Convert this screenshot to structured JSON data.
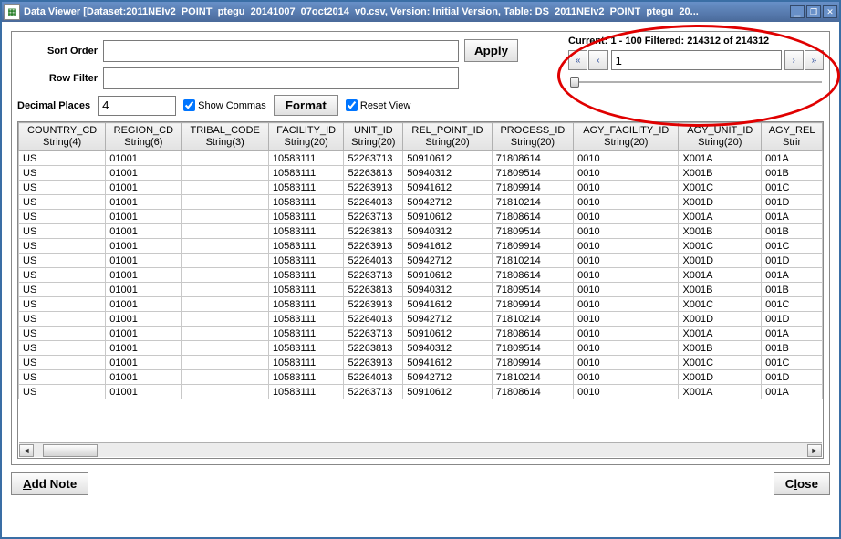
{
  "window": {
    "title": "Data Viewer [Dataset:2011NEIv2_POINT_ptegu_20141007_07oct2014_v0.csv, Version: Initial Version, Table: DS_2011NEIv2_POINT_ptegu_20..."
  },
  "filters": {
    "sort_label": "Sort Order",
    "sort_value": "",
    "rowfilter_label": "Row Filter",
    "rowfilter_value": "",
    "apply_label": "Apply"
  },
  "format": {
    "decimal_label": "Decimal Places",
    "decimal_value": "4",
    "show_commas_label": "Show Commas",
    "show_commas_checked": true,
    "format_label": "Format",
    "reset_view_label": "Reset View",
    "reset_view_checked": true
  },
  "pager": {
    "current_label": "Current:",
    "current_range": "1 - 100",
    "filtered_label": "Filtered:",
    "filtered_count": "214312",
    "of_label": "of",
    "total_count": "214312",
    "page_value": "1"
  },
  "columns": [
    {
      "name": "COUNTRY_CD",
      "type": "String(4)"
    },
    {
      "name": "REGION_CD",
      "type": "String(6)"
    },
    {
      "name": "TRIBAL_CODE",
      "type": "String(3)"
    },
    {
      "name": "FACILITY_ID",
      "type": "String(20)"
    },
    {
      "name": "UNIT_ID",
      "type": "String(20)"
    },
    {
      "name": "REL_POINT_ID",
      "type": "String(20)"
    },
    {
      "name": "PROCESS_ID",
      "type": "String(20)"
    },
    {
      "name": "AGY_FACILITY_ID",
      "type": "String(20)"
    },
    {
      "name": "AGY_UNIT_ID",
      "type": "String(20)"
    },
    {
      "name": "AGY_REL",
      "type": "Strir"
    }
  ],
  "rows": [
    [
      "US",
      "01001",
      "",
      "10583111",
      "52263713",
      "50910612",
      "71808614",
      "0010",
      "X001A",
      "001A"
    ],
    [
      "US",
      "01001",
      "",
      "10583111",
      "52263813",
      "50940312",
      "71809514",
      "0010",
      "X001B",
      "001B"
    ],
    [
      "US",
      "01001",
      "",
      "10583111",
      "52263913",
      "50941612",
      "71809914",
      "0010",
      "X001C",
      "001C"
    ],
    [
      "US",
      "01001",
      "",
      "10583111",
      "52264013",
      "50942712",
      "71810214",
      "0010",
      "X001D",
      "001D"
    ],
    [
      "US",
      "01001",
      "",
      "10583111",
      "52263713",
      "50910612",
      "71808614",
      "0010",
      "X001A",
      "001A"
    ],
    [
      "US",
      "01001",
      "",
      "10583111",
      "52263813",
      "50940312",
      "71809514",
      "0010",
      "X001B",
      "001B"
    ],
    [
      "US",
      "01001",
      "",
      "10583111",
      "52263913",
      "50941612",
      "71809914",
      "0010",
      "X001C",
      "001C"
    ],
    [
      "US",
      "01001",
      "",
      "10583111",
      "52264013",
      "50942712",
      "71810214",
      "0010",
      "X001D",
      "001D"
    ],
    [
      "US",
      "01001",
      "",
      "10583111",
      "52263713",
      "50910612",
      "71808614",
      "0010",
      "X001A",
      "001A"
    ],
    [
      "US",
      "01001",
      "",
      "10583111",
      "52263813",
      "50940312",
      "71809514",
      "0010",
      "X001B",
      "001B"
    ],
    [
      "US",
      "01001",
      "",
      "10583111",
      "52263913",
      "50941612",
      "71809914",
      "0010",
      "X001C",
      "001C"
    ],
    [
      "US",
      "01001",
      "",
      "10583111",
      "52264013",
      "50942712",
      "71810214",
      "0010",
      "X001D",
      "001D"
    ],
    [
      "US",
      "01001",
      "",
      "10583111",
      "52263713",
      "50910612",
      "71808614",
      "0010",
      "X001A",
      "001A"
    ],
    [
      "US",
      "01001",
      "",
      "10583111",
      "52263813",
      "50940312",
      "71809514",
      "0010",
      "X001B",
      "001B"
    ],
    [
      "US",
      "01001",
      "",
      "10583111",
      "52263913",
      "50941612",
      "71809914",
      "0010",
      "X001C",
      "001C"
    ],
    [
      "US",
      "01001",
      "",
      "10583111",
      "52264013",
      "50942712",
      "71810214",
      "0010",
      "X001D",
      "001D"
    ],
    [
      "US",
      "01001",
      "",
      "10583111",
      "52263713",
      "50910612",
      "71808614",
      "0010",
      "X001A",
      "001A"
    ]
  ],
  "footer": {
    "add_note_label": "Add Note",
    "close_label": "Close"
  }
}
